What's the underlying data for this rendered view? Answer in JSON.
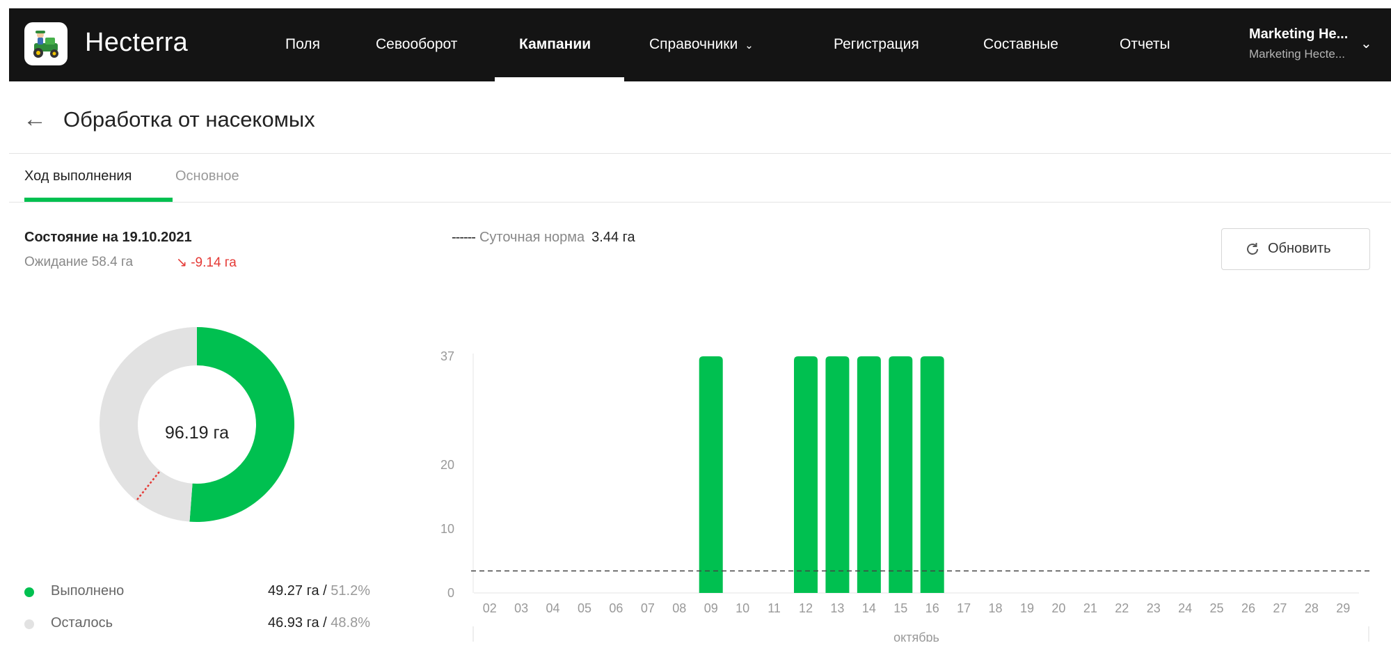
{
  "app": {
    "brand": "Hecterra",
    "nav": [
      {
        "label": "Поля"
      },
      {
        "label": "Севооборот"
      },
      {
        "label": "Кампании",
        "active": true
      },
      {
        "label": "Справочники",
        "dropdown": true
      },
      {
        "label": "Регистрация"
      },
      {
        "label": "Составные"
      },
      {
        "label": "Отчеты"
      }
    ],
    "user": {
      "name": "Marketing He...",
      "org": "Marketing Hecte..."
    }
  },
  "page": {
    "title": "Обработка от насекомых",
    "tabs": [
      {
        "label": "Ход выполнения",
        "active": true
      },
      {
        "label": "Основное",
        "active": false
      }
    ]
  },
  "summary": {
    "state_label": "Состояние на 19.10.2021",
    "expected": "Ожидание 58.4 га",
    "delta": "-9.14 га",
    "total": "96.19 га",
    "done_fraction": 0.512,
    "expected_fraction": 0.607,
    "legend": [
      {
        "label": "Выполнено",
        "value": "49.27 га",
        "pct": "51.2%",
        "color": "#00c050"
      },
      {
        "label": "Осталось",
        "value": "46.93 га",
        "pct": "48.8%",
        "color": "#e2e2e2"
      }
    ]
  },
  "norm": {
    "label": "Суточная норма",
    "value": "3.44 га"
  },
  "refresh_label": "Обновить",
  "chart_data": {
    "type": "bar",
    "categories": [
      "02",
      "03",
      "04",
      "05",
      "06",
      "07",
      "08",
      "09",
      "10",
      "11",
      "12",
      "13",
      "14",
      "15",
      "16",
      "17",
      "18",
      "19",
      "20",
      "21",
      "22",
      "23",
      "24",
      "25",
      "26",
      "27",
      "28",
      "29"
    ],
    "values": [
      0,
      0,
      0,
      0,
      0,
      0,
      0,
      37,
      0,
      0,
      37,
      37,
      37,
      37,
      37,
      0,
      0,
      0,
      0,
      0,
      0,
      0,
      0,
      0,
      0,
      0,
      0,
      0
    ],
    "yticks": [
      0,
      10,
      20,
      37
    ],
    "ylim": [
      0,
      37
    ],
    "reference_line": 3.44,
    "xgroup_label": "октябрь",
    "bar_color": "#00c050"
  }
}
